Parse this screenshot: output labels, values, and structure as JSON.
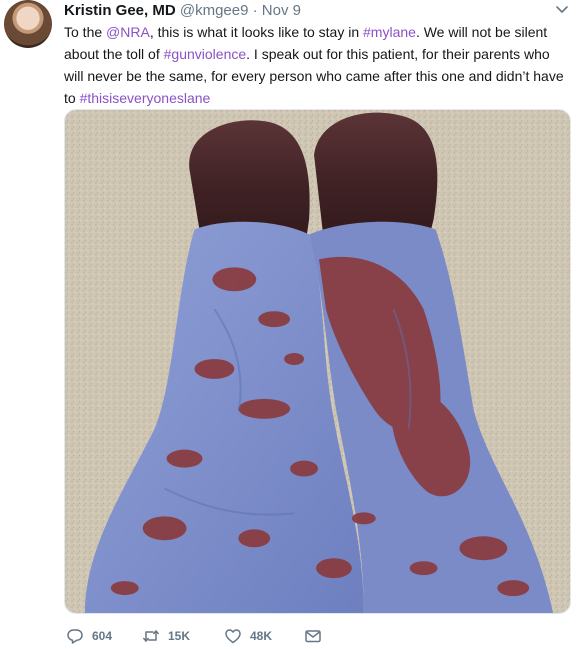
{
  "author": {
    "name": "Kristin Gee, MD",
    "handle": "@kmgee9",
    "separator": "·",
    "time": "Nov 9"
  },
  "tweet": {
    "segments": [
      {
        "text": "To the ",
        "link": false
      },
      {
        "text": "@NRA",
        "link": true
      },
      {
        "text": ", this is what it looks like to stay in ",
        "link": false
      },
      {
        "text": "#mylane",
        "link": true
      },
      {
        "text": ". We will not be silent about the toll of ",
        "link": false
      },
      {
        "text": "#gunviolence",
        "link": true
      },
      {
        "text": ". I speak out for this patient, for their parents who will never be the same, for every person who came after this one and didn’t have to ",
        "link": false
      },
      {
        "text": "#thisiseveryoneslane",
        "link": true
      }
    ]
  },
  "actions": {
    "reply_count": "604",
    "retweet_count": "15K",
    "like_count": "48K"
  },
  "icons": {
    "caret": "chevron-down-icon",
    "reply": "reply-icon",
    "retweet": "retweet-icon",
    "like": "heart-icon",
    "dm": "envelope-icon"
  },
  "colors": {
    "link": "#8a52c4",
    "secondary_text": "#657786",
    "primary_text": "#14171a"
  }
}
